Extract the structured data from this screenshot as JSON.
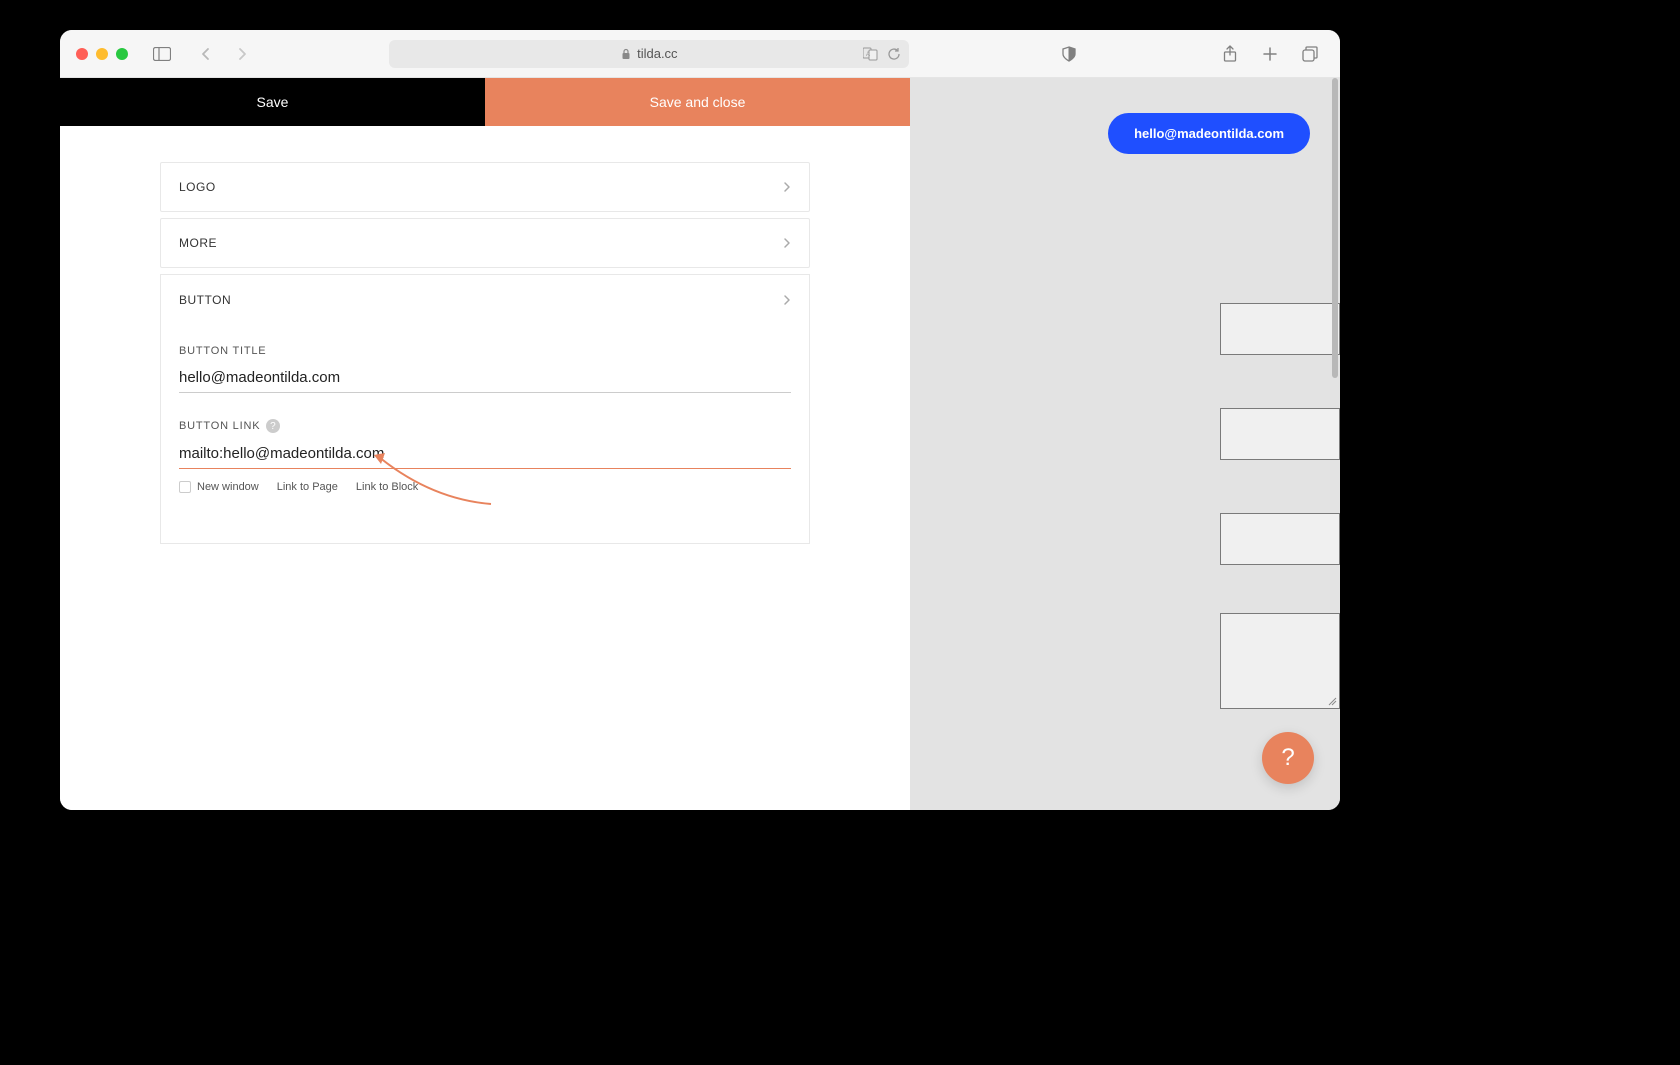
{
  "browser": {
    "url": "tilda.cc"
  },
  "savebar": {
    "save_label": "Save",
    "save_close_label": "Save and close"
  },
  "sections": {
    "logo_label": "LOGO",
    "more_label": "MORE",
    "button_label": "BUTTON"
  },
  "button_form": {
    "title_label": "BUTTON TITLE",
    "title_value": "hello@madeontilda.com",
    "link_label": "BUTTON LINK",
    "link_value": "mailto:hello@madeontilda.com",
    "new_window_label": "New window",
    "link_to_page": "Link to Page",
    "link_to_block": "Link to Block"
  },
  "preview": {
    "button_text": "hello@madeontilda.com"
  },
  "help_fab": "?"
}
